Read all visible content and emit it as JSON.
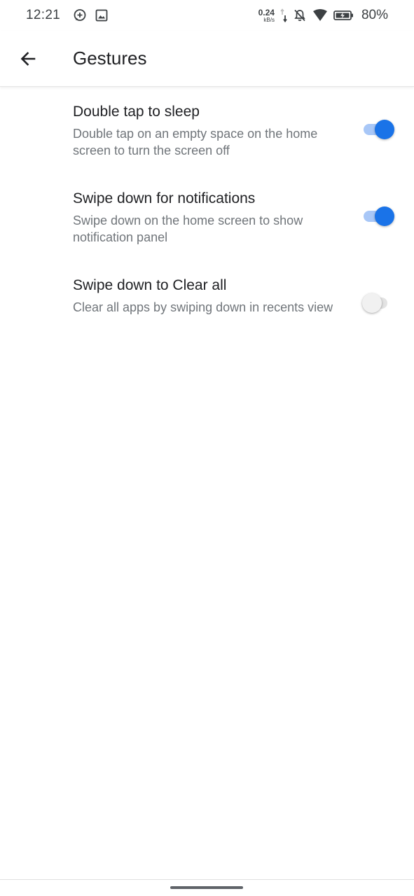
{
  "status_bar": {
    "time": "12:21",
    "net_speed_value": "0.24",
    "net_speed_unit": "kB/s",
    "battery_percent": "80%",
    "icons": [
      "whatsapp-icon",
      "image-icon",
      "network-arrows-icon",
      "bell-off-icon",
      "wifi-icon",
      "battery-charging-icon"
    ]
  },
  "app_bar": {
    "back_icon": "arrow-back-icon",
    "title": "Gestures"
  },
  "settings": [
    {
      "title": "Double tap to sleep",
      "summary": "Double tap on an empty space on the home screen to turn the screen off",
      "enabled": true
    },
    {
      "title": "Swipe down for notifications",
      "summary": "Swipe down on the home screen to show notification panel",
      "enabled": true
    },
    {
      "title": "Swipe down to Clear all",
      "summary": "Clear all apps by swiping down in recents view",
      "enabled": false
    }
  ],
  "colors": {
    "accent": "#1a73e8",
    "accent_track": "#a8c7f7",
    "off_track": "#e3e3e3",
    "title_text": "#202124",
    "summary_text": "#70757a"
  }
}
